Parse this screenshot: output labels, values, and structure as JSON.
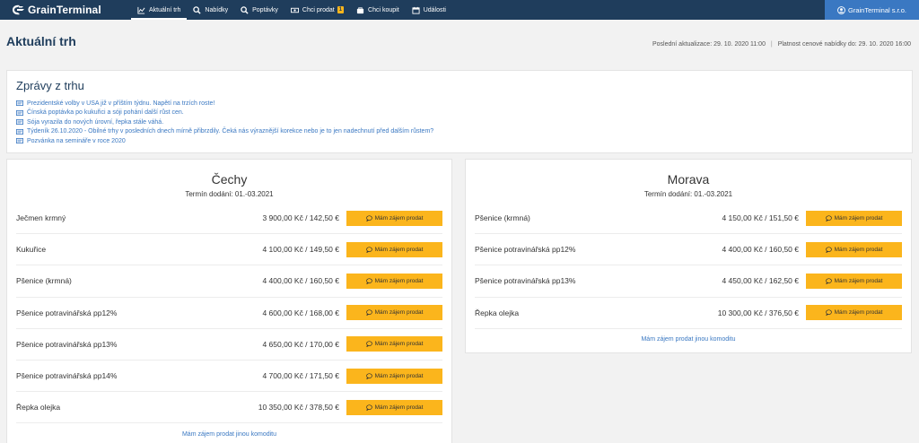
{
  "header": {
    "logo_text": "GrainTerminal",
    "nav": [
      {
        "label": "Aktuální trh",
        "icon": "chart-line-icon",
        "active": true
      },
      {
        "label": "Nabídky",
        "icon": "search-icon"
      },
      {
        "label": "Poptávky",
        "icon": "search-icon"
      },
      {
        "label": "Chci prodat",
        "icon": "money-icon",
        "badge": "1"
      },
      {
        "label": "Chci koupit",
        "icon": "cart-icon"
      },
      {
        "label": "Události",
        "icon": "calendar-icon"
      }
    ],
    "account_label": "GrainTerminal s.r.o."
  },
  "page": {
    "title": "Aktuální trh",
    "last_update_label": "Poslední aktualizace:",
    "last_update_value": "29. 10. 2020 11:00",
    "validity_label": "Platnost cenové nabídky do:",
    "validity_value": "29. 10. 2020 16:00"
  },
  "news": {
    "title": "Zprávy z trhu",
    "items": [
      "Prezidentské volby v USA již v příštím týdnu. Napětí na trzích roste!",
      "Čínská poptávka po kukuřici a sóji pohání další růst cen.",
      "Sója vyrazila do nových úrovní, řepka stále váhá.",
      "Týdeník 26.10.2020 - Obilné trhy v posledních dnech mírně přibrzdily. Čeká nás výraznější korekce nebo je to jen nadechnutí před dalším růstem?",
      "Pozvánka na semináře v roce 2020"
    ]
  },
  "regions": {
    "cechy": {
      "title": "Čechy",
      "delivery": "Termín dodání: 01.-03.2021",
      "rows": [
        {
          "name": "Ječmen krmný",
          "price": "3 900,00 Kč / 142,50 €"
        },
        {
          "name": "Kukuřice",
          "price": "4 100,00 Kč / 149,50 €"
        },
        {
          "name": "Pšenice (krmná)",
          "price": "4 400,00 Kč / 160,50 €"
        },
        {
          "name": "Pšenice potravinářská pp12%",
          "price": "4 600,00 Kč / 168,00 €"
        },
        {
          "name": "Pšenice potravinářská pp13%",
          "price": "4 650,00 Kč / 170,00 €"
        },
        {
          "name": "Pšenice potravinářská pp14%",
          "price": "4 700,00 Kč / 171,50 €"
        },
        {
          "name": "Řepka olejka",
          "price": "10 350,00 Kč / 378,50 €"
        }
      ],
      "other_link": "Mám zájem prodat jinou komoditu"
    },
    "morava": {
      "title": "Morava",
      "delivery": "Termín dodání: 01.-03.2021",
      "rows": [
        {
          "name": "Pšenice (krmná)",
          "price": "4 150,00 Kč / 151,50 €"
        },
        {
          "name": "Pšenice potravinářská pp12%",
          "price": "4 400,00 Kč / 160,50 €"
        },
        {
          "name": "Pšenice potravinářská pp13%",
          "price": "4 450,00 Kč / 162,50 €"
        },
        {
          "name": "Řepka olejka",
          "price": "10 300,00 Kč / 376,50 €"
        }
      ],
      "other_link": "Mám zájem prodat jinou komoditu"
    }
  },
  "button_label": "Mám zájem prodat",
  "colors": {
    "navbar": "#1f3d5c",
    "account": "#3a78c2",
    "accent": "#fbb51c",
    "link": "#3a78c2"
  }
}
